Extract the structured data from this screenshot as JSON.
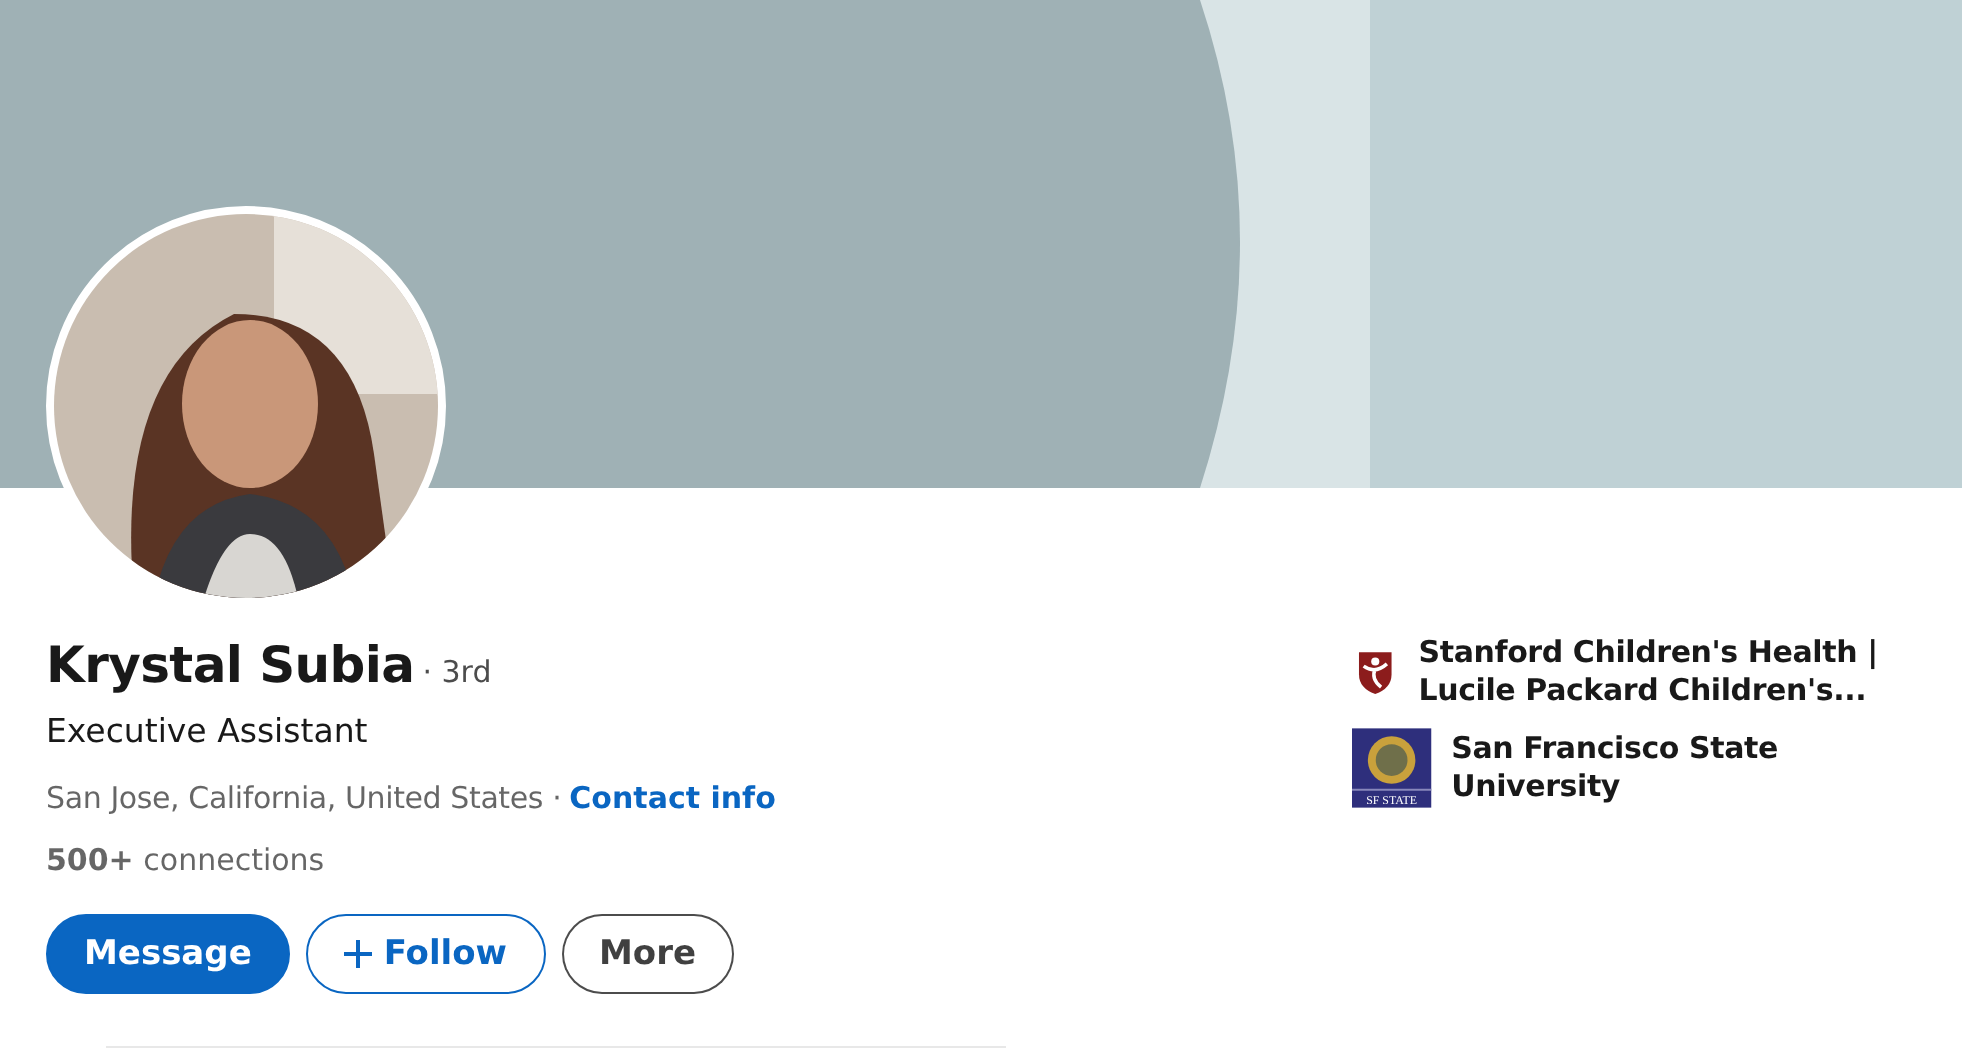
{
  "profile": {
    "name": "Krystal Subia",
    "degree": "· 3rd",
    "headline": "Executive Assistant",
    "location": "San Jose, California, United States ·",
    "contact_link": "Contact info",
    "connections": "**500+** connections"
  },
  "buttons": [
    {
      "label": "Message",
      "kind": "primary"
    },
    {
      "label": "Follow",
      "kind": "follow"
    },
    {
      "label": "More",
      "kind": "secondary"
    }
  ],
  "organizations": [
    {
      "name": "Stanford Children's Health | Lucile Packard Children's...",
      "kind": "shield"
    },
    {
      "name": "San Francisco State University",
      "kind": "seal",
      "logo_text": "SF STATE"
    }
  ]
}
